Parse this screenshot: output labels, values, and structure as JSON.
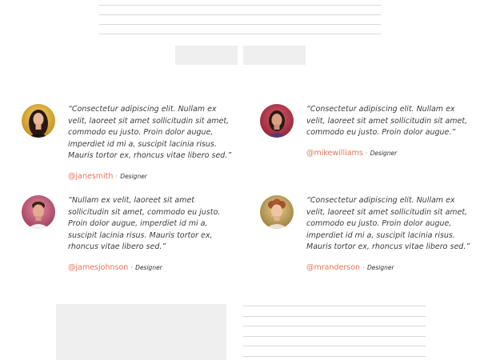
{
  "testimonials": [
    {
      "quote": "“Consectetur adipiscing elit. Nullam ex velit, laoreet sit amet sollicitudin sit amet, commodo eu justo. Proin dolor augue, imperdiet id mi a, suscipit lacinia risus. Mauris tortor ex, rhoncus vitae libero sed.”",
      "handle": "@janesmith",
      "separator": "·",
      "role": "Designer"
    },
    {
      "quote": "“Consectetur adipiscing elit. Nullam ex velit, laoreet sit amet sollicitudin sit amet, commodo eu justo. Proin dolor augue.”",
      "handle": "@mikewilliams",
      "separator": "·",
      "role": "Designer"
    },
    {
      "quote": "“Nullam ex velit, laoreet sit amet sollicitudin sit amet, commodo eu justo. Proin dolor augue, imperdiet id mi a, suscipit lacinia risus. Mauris tortor ex, rhoncus vitae libero sed.”",
      "handle": "@jamesjohnson",
      "separator": "·",
      "role": "Designer"
    },
    {
      "quote": "“Consectetur adipiscing elit. Nullam ex velit, laoreet sit amet sollicitudin sit amet, commodo eu justo. Proin dolor augue, imperdiet id mi a, suscipit lacinia risus. Mauris tortor ex, rhoncus vitae libero sed.”",
      "handle": "@mranderson",
      "separator": "·",
      "role": "Designer"
    }
  ],
  "colors": {
    "accent": "#e9735a",
    "placeholder": "#efefef",
    "rule": "#d9d9d9",
    "text": "#3d3d3d"
  }
}
